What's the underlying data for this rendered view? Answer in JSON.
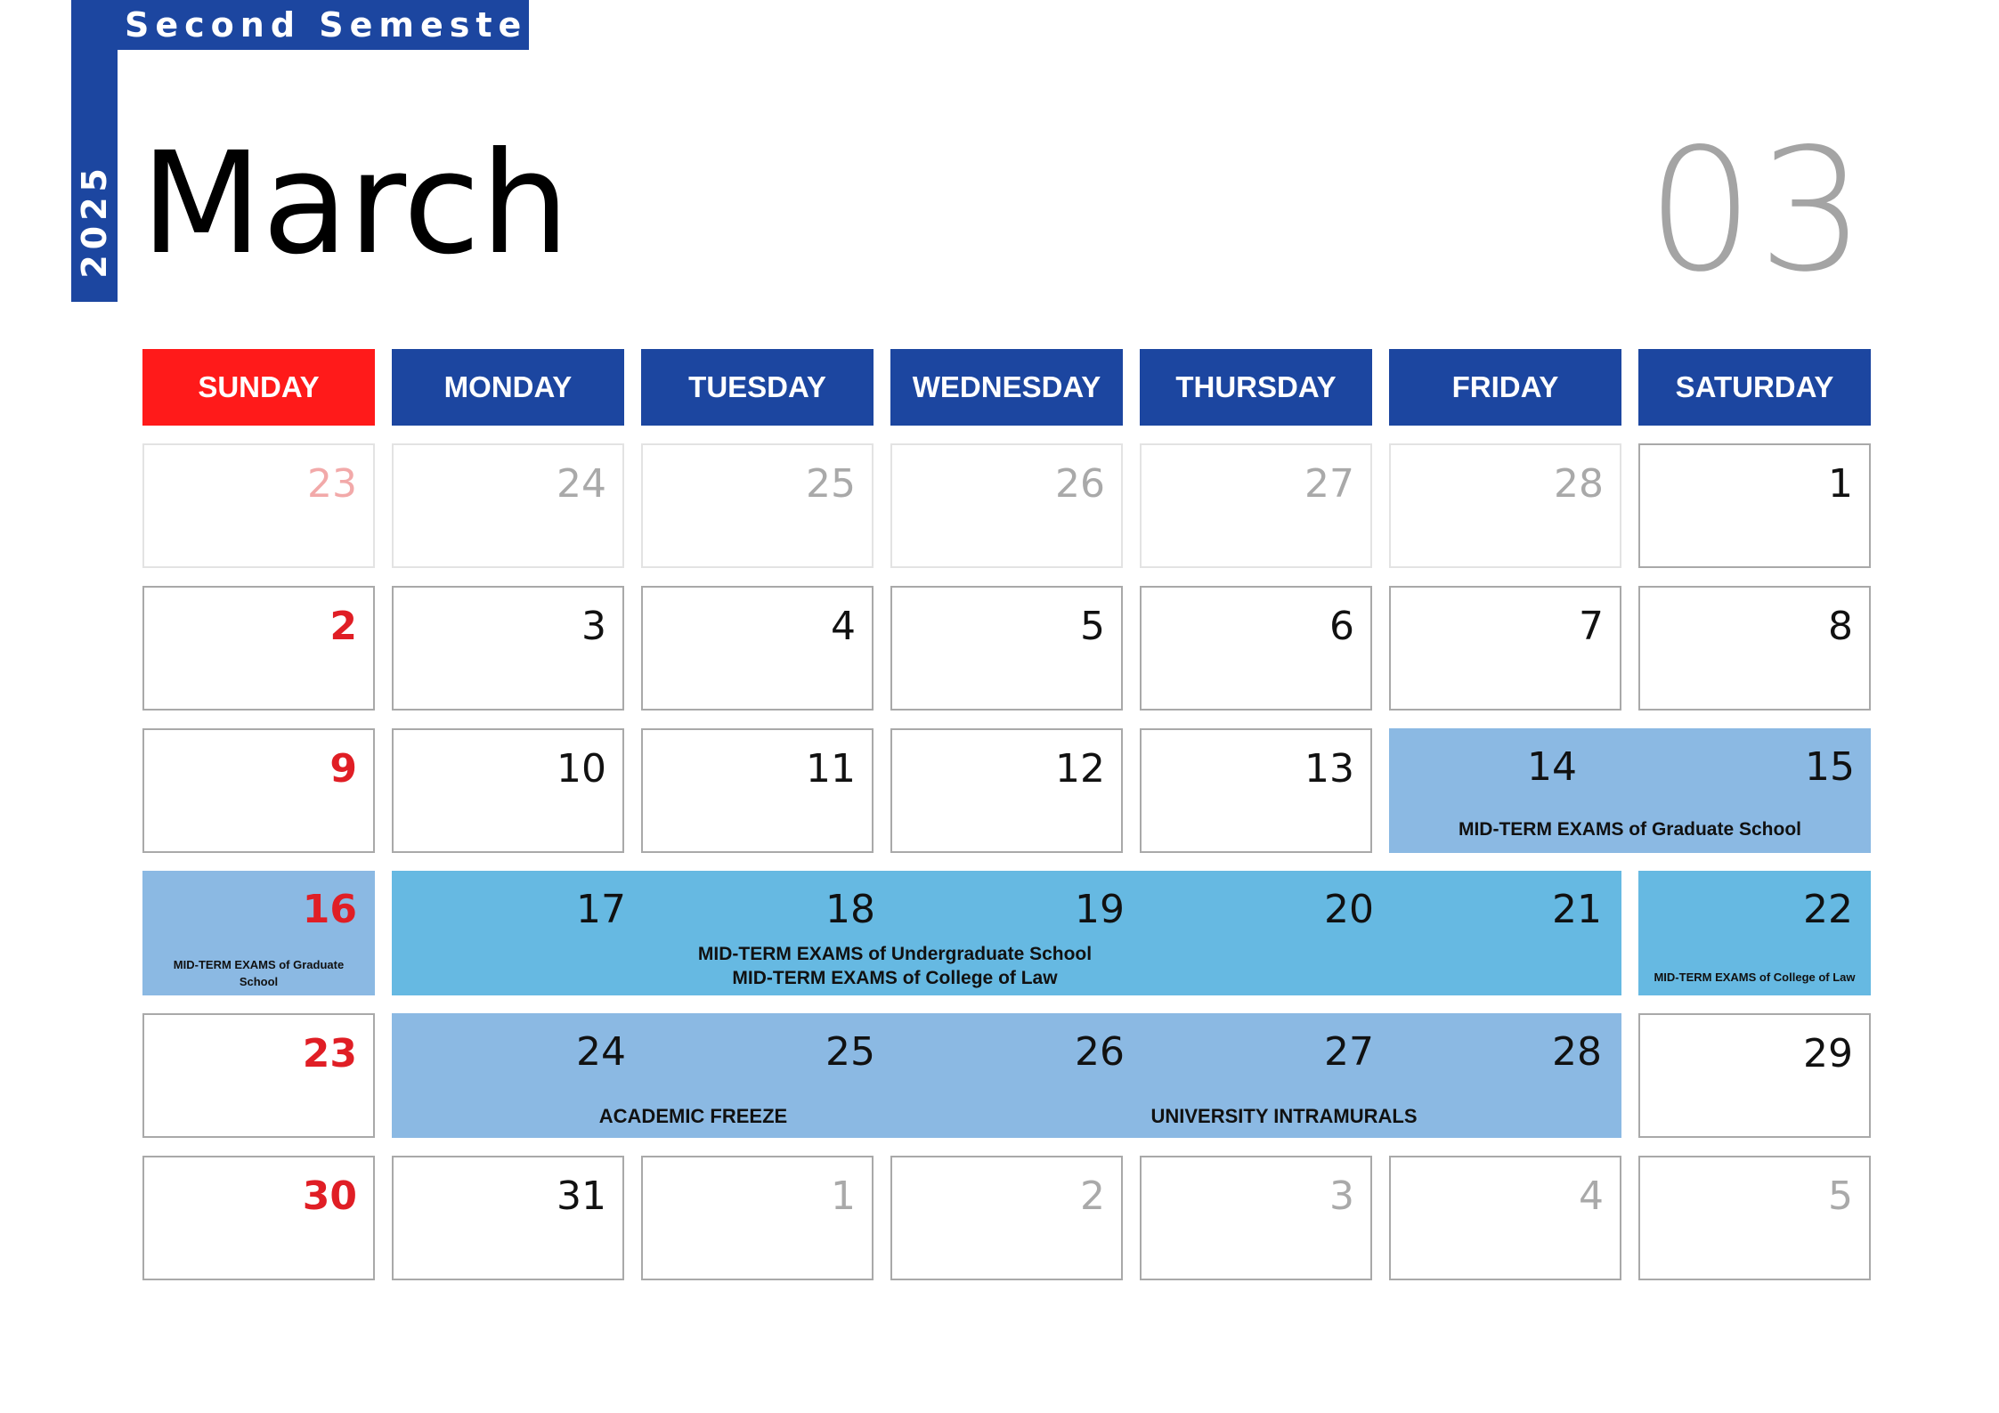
{
  "header": {
    "semester": "Second Semester",
    "year": "2025",
    "month_name": "March",
    "month_number": "03"
  },
  "weekdays": [
    "SUNDAY",
    "MONDAY",
    "TUESDAY",
    "WEDNESDAY",
    "THURSDAY",
    "FRIDAY",
    "SATURDAY"
  ],
  "weeks": [
    [
      "23",
      "24",
      "25",
      "26",
      "27",
      "28",
      "1"
    ],
    [
      "2",
      "3",
      "4",
      "5",
      "6",
      "7",
      "8"
    ],
    [
      "9",
      "10",
      "11",
      "12",
      "13",
      "14",
      "15"
    ],
    [
      "16",
      "17",
      "18",
      "19",
      "20",
      "21",
      "22"
    ],
    [
      "23",
      "24",
      "25",
      "26",
      "27",
      "28",
      "29"
    ],
    [
      "30",
      "31",
      "1",
      "2",
      "3",
      "4",
      "5"
    ]
  ],
  "events": {
    "grad_midterm": "MID-TERM EXAMS of Graduate School",
    "grad_midterm_small_line1": "MID-TERM EXAMS of Graduate",
    "grad_midterm_small_line2": "School",
    "undergrad_midterm": "MID-TERM EXAMS of Undergraduate School",
    "law_midterm": "MID-TERM EXAMS of College of Law",
    "law_midterm_small": "MID-TERM EXAMS of College of Law",
    "academic_freeze": "ACADEMIC FREEZE",
    "intramurals": "UNIVERSITY INTRAMURALS"
  },
  "colors": {
    "brand_blue": "#1c46a0",
    "sunday_red": "#ff1a1a",
    "event_blue_dark": "#8bb9e3",
    "event_blue_light": "#66b9e2",
    "month_number_gray": "#a4a4a4"
  }
}
